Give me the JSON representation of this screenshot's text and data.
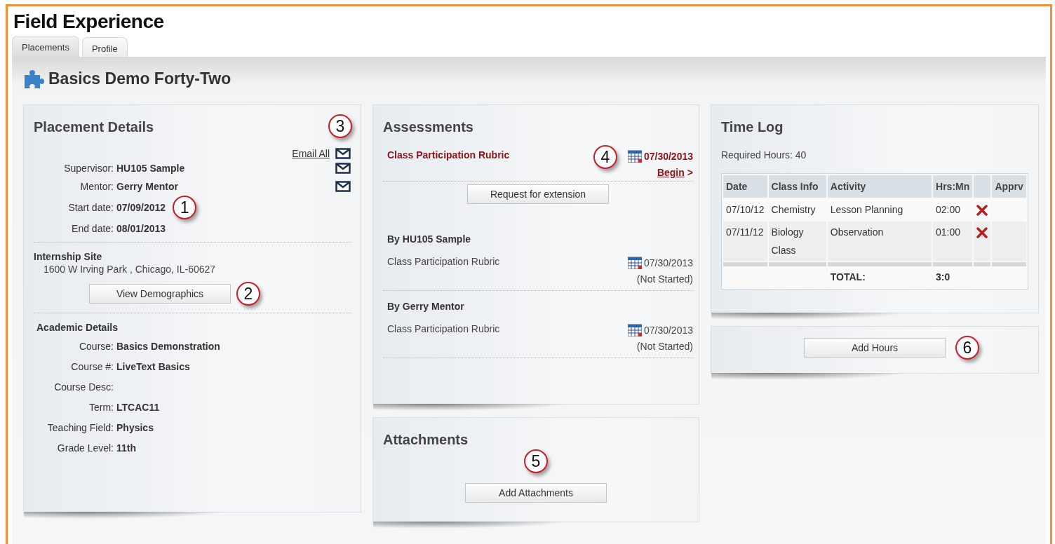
{
  "page_title": "Field Experience",
  "tabs": [
    {
      "label": "Placements",
      "selected": true
    },
    {
      "label": "Profile",
      "selected": false
    }
  ],
  "placement_name": "Basics Demo Forty-Two",
  "placement_details": {
    "title": "Placement Details",
    "email_all": {
      "label": "Email All",
      "callout": "3"
    },
    "people": [
      {
        "label": "Supervisor:",
        "value": "HU105 Sample",
        "kind": "contact"
      },
      {
        "label": "Mentor:",
        "value": "Gerry Mentor",
        "kind": "contact"
      },
      {
        "label": "Start date:",
        "value": "07/09/2012",
        "kind": "date",
        "callout": "1"
      },
      {
        "label": "End date:",
        "value": "08/01/2013",
        "kind": "date"
      }
    ],
    "site": {
      "title": "Internship Site",
      "address": "1600 W Irving Park , Chicago, IL-60627",
      "button": "View Demographics",
      "callout": "2"
    },
    "academic": {
      "title": "Academic Details",
      "fields": [
        {
          "label": "Course:",
          "value": "Basics Demonstration"
        },
        {
          "label": "Course #:",
          "value": "LiveText Basics"
        },
        {
          "label": "Course Desc:"
        },
        {
          "label": "Term:",
          "value": "LTCAC11"
        },
        {
          "label": "Teaching Field:",
          "value": "Physics"
        },
        {
          "label": "Grade Level:",
          "value": "11th"
        }
      ]
    }
  },
  "assessments": {
    "title": "Assessments",
    "current": {
      "name": "Class Participation Rubric",
      "due": "07/30/2013",
      "action": "Begin",
      "arrow": ">",
      "callout": "4",
      "button": "Request for extension"
    },
    "groups": [
      {
        "title": "By HU105 Sample",
        "items": [
          {
            "name": "Class Participation Rubric",
            "due": "07/30/2013",
            "status": "(Not Started)"
          }
        ]
      },
      {
        "title": "By Gerry Mentor",
        "items": [
          {
            "name": "Class Participation Rubric",
            "due": "07/30/2013",
            "status": "(Not Started)"
          }
        ]
      }
    ]
  },
  "attachments": {
    "title": "Attachments",
    "button": "Add Attachments",
    "callout": "5"
  },
  "time_log": {
    "title": "Time Log",
    "required": "Required Hours: 40",
    "columns": [
      "Date",
      "Class Info",
      "Activity",
      "Hrs:Mn",
      "Apprv"
    ],
    "rows": [
      {
        "date": "07/10/12",
        "class_info": "Chemistry",
        "activity": "Lesson Planning",
        "hours": "02:00",
        "deletable": true
      },
      {
        "date": "07/11/12",
        "class_info": "Biology Class",
        "activity": "Observation",
        "hours": "01:00",
        "deletable": true
      }
    ],
    "total_label": "TOTAL:",
    "total": "3:0",
    "button": "Add Hours",
    "callout": "6"
  }
}
